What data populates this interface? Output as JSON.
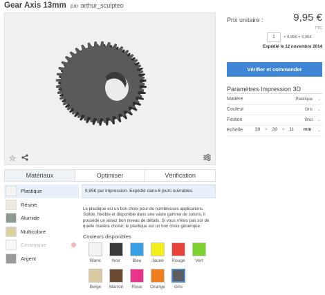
{
  "product": {
    "title": "Gear Axis 13mm",
    "by": "par",
    "author": "arthur_sculpteo"
  },
  "viewer": {
    "icons": [
      "star-icon",
      "share-icon",
      "settings-sliders-icon"
    ]
  },
  "tabs": [
    "Matériaux",
    "Optimiser",
    "Vérification"
  ],
  "materials": [
    {
      "label": "Plastique",
      "color": "#f4f4f4",
      "active": true,
      "disabled": false
    },
    {
      "label": "Résine",
      "color": "#efeae0",
      "active": false,
      "disabled": false
    },
    {
      "label": "Alumide",
      "color": "#8a9a8e",
      "active": false,
      "disabled": false
    },
    {
      "label": "Multicolore",
      "color": "#d9cfa0",
      "active": false,
      "disabled": false
    },
    {
      "label": "Céramique",
      "color": "#f7f7f7",
      "active": false,
      "disabled": true
    },
    {
      "label": "Argent",
      "color": "#9a9a9a",
      "active": false,
      "disabled": false
    }
  ],
  "material_info": "9,95€ par impression. Expédié dans 6 jours ouvrables.",
  "material_desc": "Le plastique est un bon choix pour de nombreuses applications. Solide, flexible et disponible dans une vaste gamme de coloris, il possède un assez bon niveau de détails. Si vous n'êtes pas sûr de quelle matière choisir, le plastique est un bon choix générique.",
  "colors_title": "Couleurs disponibles",
  "colors": [
    {
      "name": "Blanc",
      "hex": "#f2f2f2",
      "selected": false
    },
    {
      "name": "Noir",
      "hex": "#3a3a3a",
      "selected": false
    },
    {
      "name": "Bleu",
      "hex": "#3a9ee2",
      "selected": false
    },
    {
      "name": "Jaune",
      "hex": "#f3ee1a",
      "selected": false
    },
    {
      "name": "Rouge",
      "hex": "#e8433b",
      "selected": false
    },
    {
      "name": "Vert",
      "hex": "#7ed12e",
      "selected": false
    },
    {
      "name": "Beige",
      "hex": "#d9c9a0",
      "selected": false
    },
    {
      "name": "Marron",
      "hex": "#6b4a33",
      "selected": false
    },
    {
      "name": "Rose",
      "hex": "#e8348a",
      "selected": false
    },
    {
      "name": "Orange",
      "hex": "#f07d1e",
      "selected": false
    },
    {
      "name": "Gris",
      "hex": "#5e5e5e",
      "selected": true
    }
  ],
  "pricing": {
    "label": "Prix unitaire :",
    "value": "9,95 €",
    "ttc": "TTC",
    "quantity": "1",
    "calc": "× 9,95€ = 9,95€",
    "shipping": "Expédié le 12 novembre 2014"
  },
  "cta_label": "Vérifier et commander",
  "params": {
    "title": "Paramètres Impression 3D",
    "rows": [
      {
        "label": "Matière",
        "value": "Plastique"
      },
      {
        "label": "Couleur",
        "value": "Gris"
      },
      {
        "label": "Finition",
        "value": "Brut"
      }
    ],
    "scale_label": "Echelle",
    "dims": [
      "39",
      "39",
      "11"
    ],
    "unit": "mm",
    "times": "×"
  },
  "colors_ui": {
    "accent": "#3f87d6",
    "active_bg": "#e8f1fb"
  }
}
